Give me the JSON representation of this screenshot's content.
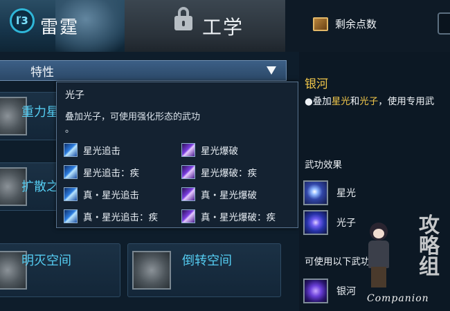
{
  "tabs": {
    "leiting": {
      "label": "雷霆",
      "icon": "lightning-emblem-icon",
      "icon_text": "ľ3"
    },
    "gongxue": {
      "label": "工学",
      "icon": "lock-icon"
    }
  },
  "top_bar": {
    "remaining_points_label": "剩余点数",
    "book_icon": "book-icon"
  },
  "feature_panel": {
    "header_label": "特性",
    "dropdown_icon": "triangle-down-icon",
    "skills": [
      {
        "name": "重力星"
      },
      {
        "name": "扩散之"
      },
      {
        "name": "明灭空间"
      },
      {
        "name": "倒转空间"
      }
    ]
  },
  "tooltip": {
    "title": "光子",
    "description": "叠加光子，可使用强化形态的武功\n。",
    "items_left": [
      {
        "label": "星光追击",
        "icon": "blue"
      },
      {
        "label": "星光追击：疾",
        "icon": "blue"
      },
      {
        "label": "真・星光追击",
        "icon": "blue"
      },
      {
        "label": "真・星光追击：疾",
        "icon": "blue"
      }
    ],
    "items_right": [
      {
        "label": "星光爆破",
        "icon": "purple"
      },
      {
        "label": "星光爆破：疾",
        "icon": "purple"
      },
      {
        "label": "真・星光爆破",
        "icon": "purple"
      },
      {
        "label": "真・星光爆破：疾",
        "icon": "purple"
      }
    ]
  },
  "right_panel": {
    "title": "银河",
    "desc_prefix": "●叠加",
    "desc_hl1": "星光",
    "desc_mid": "和",
    "desc_hl2": "光子",
    "desc_suffix": "，使用专用武",
    "section_effects": "武功效果",
    "effects": [
      {
        "label": "星光",
        "icon": "star-icon"
      },
      {
        "label": "光子",
        "icon": "photon-icon"
      }
    ],
    "section_usable": "可使用以下武功",
    "usable": [
      {
        "label": "银河",
        "icon": "galaxy-icon"
      }
    ]
  },
  "watermark": {
    "text": "Companion",
    "calligraphy": "攻略组"
  },
  "colors": {
    "highlight": "#f0c64a",
    "skill_name": "#55cdf2",
    "header_bg": "#3c5f86"
  }
}
